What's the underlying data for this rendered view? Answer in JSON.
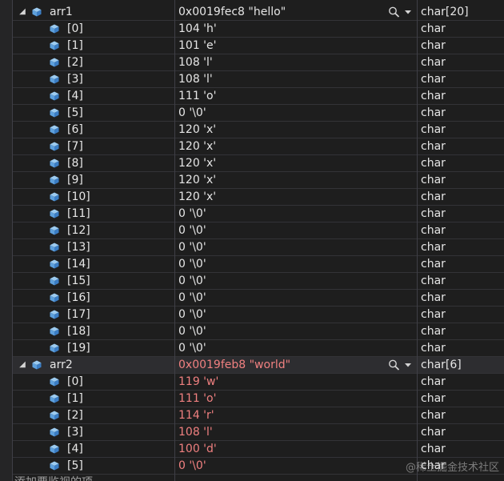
{
  "groups": [
    {
      "name": "arr1",
      "value": "0x0019fec8 \"hello\"",
      "type": "char[20]",
      "changed": false,
      "selected": false,
      "items": [
        {
          "index": "[0]",
          "value": "104 'h'",
          "type": "char",
          "changed": false
        },
        {
          "index": "[1]",
          "value": "101 'e'",
          "type": "char",
          "changed": false
        },
        {
          "index": "[2]",
          "value": "108 'l'",
          "type": "char",
          "changed": false
        },
        {
          "index": "[3]",
          "value": "108 'l'",
          "type": "char",
          "changed": false
        },
        {
          "index": "[4]",
          "value": "111 'o'",
          "type": "char",
          "changed": false
        },
        {
          "index": "[5]",
          "value": "0 '\\0'",
          "type": "char",
          "changed": false
        },
        {
          "index": "[6]",
          "value": "120 'x'",
          "type": "char",
          "changed": false
        },
        {
          "index": "[7]",
          "value": "120 'x'",
          "type": "char",
          "changed": false
        },
        {
          "index": "[8]",
          "value": "120 'x'",
          "type": "char",
          "changed": false
        },
        {
          "index": "[9]",
          "value": "120 'x'",
          "type": "char",
          "changed": false
        },
        {
          "index": "[10]",
          "value": "120 'x'",
          "type": "char",
          "changed": false
        },
        {
          "index": "[11]",
          "value": "0 '\\0'",
          "type": "char",
          "changed": false
        },
        {
          "index": "[12]",
          "value": "0 '\\0'",
          "type": "char",
          "changed": false
        },
        {
          "index": "[13]",
          "value": "0 '\\0'",
          "type": "char",
          "changed": false
        },
        {
          "index": "[14]",
          "value": "0 '\\0'",
          "type": "char",
          "changed": false
        },
        {
          "index": "[15]",
          "value": "0 '\\0'",
          "type": "char",
          "changed": false
        },
        {
          "index": "[16]",
          "value": "0 '\\0'",
          "type": "char",
          "changed": false
        },
        {
          "index": "[17]",
          "value": "0 '\\0'",
          "type": "char",
          "changed": false
        },
        {
          "index": "[18]",
          "value": "0 '\\0'",
          "type": "char",
          "changed": false
        },
        {
          "index": "[19]",
          "value": "0 '\\0'",
          "type": "char",
          "changed": false
        }
      ]
    },
    {
      "name": "arr2",
      "value": "0x0019feb8 \"world\"",
      "type": "char[6]",
      "changed": true,
      "selected": true,
      "items": [
        {
          "index": "[0]",
          "value": "119 'w'",
          "type": "char",
          "changed": true
        },
        {
          "index": "[1]",
          "value": "111 'o'",
          "type": "char",
          "changed": true
        },
        {
          "index": "[2]",
          "value": "114 'r'",
          "type": "char",
          "changed": true
        },
        {
          "index": "[3]",
          "value": "108 'l'",
          "type": "char",
          "changed": true
        },
        {
          "index": "[4]",
          "value": "100 'd'",
          "type": "char",
          "changed": true
        },
        {
          "index": "[5]",
          "value": "0 '\\0'",
          "type": "char",
          "changed": true
        }
      ]
    }
  ],
  "add_item_label": "添加要监视的项",
  "watermark": "@稀土掘金技术社区",
  "colors": {
    "changed_value": "#f08080",
    "cube_icon": "#5ea0dc"
  },
  "icons": {
    "expander": "triangle-down-icon",
    "variable": "cube-icon",
    "search": "magnifier-icon",
    "dropdown": "chevron-down-icon"
  }
}
